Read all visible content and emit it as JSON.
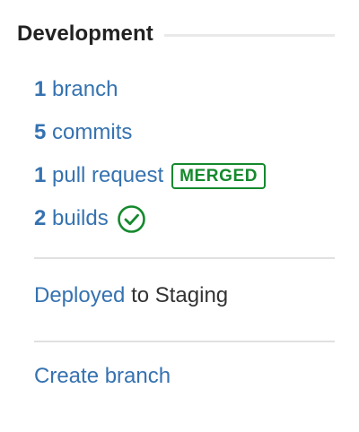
{
  "section": {
    "title": "Development"
  },
  "items": {
    "branches": {
      "count": "1",
      "label": "branch"
    },
    "commits": {
      "count": "5",
      "label": "commits"
    },
    "pull_requests": {
      "count": "1",
      "label": "pull request",
      "status": "MERGED"
    },
    "builds": {
      "count": "2",
      "label": "builds",
      "status_icon": "check-circle-icon"
    }
  },
  "deployment": {
    "link": "Deployed",
    "suffix": " to Staging"
  },
  "actions": {
    "create_branch": "Create branch"
  },
  "colors": {
    "link": "#3572b0",
    "success": "#14892c",
    "divider": "#e0e0e0",
    "heading": "#222222"
  }
}
